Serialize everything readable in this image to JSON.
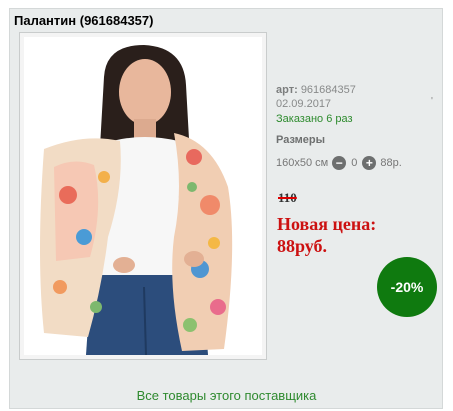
{
  "product": {
    "title": "Палантин (961684357)",
    "sku_label": "арт:",
    "sku": "961684357",
    "date": "02.09.2017",
    "ordered": "Заказано 6 раз",
    "sizes_label": "Размеры",
    "size": {
      "name": "160x50 см",
      "quantity": "0",
      "price": "88р."
    },
    "old_price": "110",
    "new_price_line1": "Новая цена:",
    "new_price_line2": "88руб.",
    "discount": "-20%",
    "supplier_link": "Все товары этого поставщика"
  },
  "icons": {
    "decrement": "minus-circle-icon",
    "increment": "plus-circle-icon"
  },
  "colors": {
    "panel": "#e9ecec",
    "price_red": "#cc1111",
    "badge_green": "#0f7a0f",
    "link_green": "#2f8a2f"
  }
}
